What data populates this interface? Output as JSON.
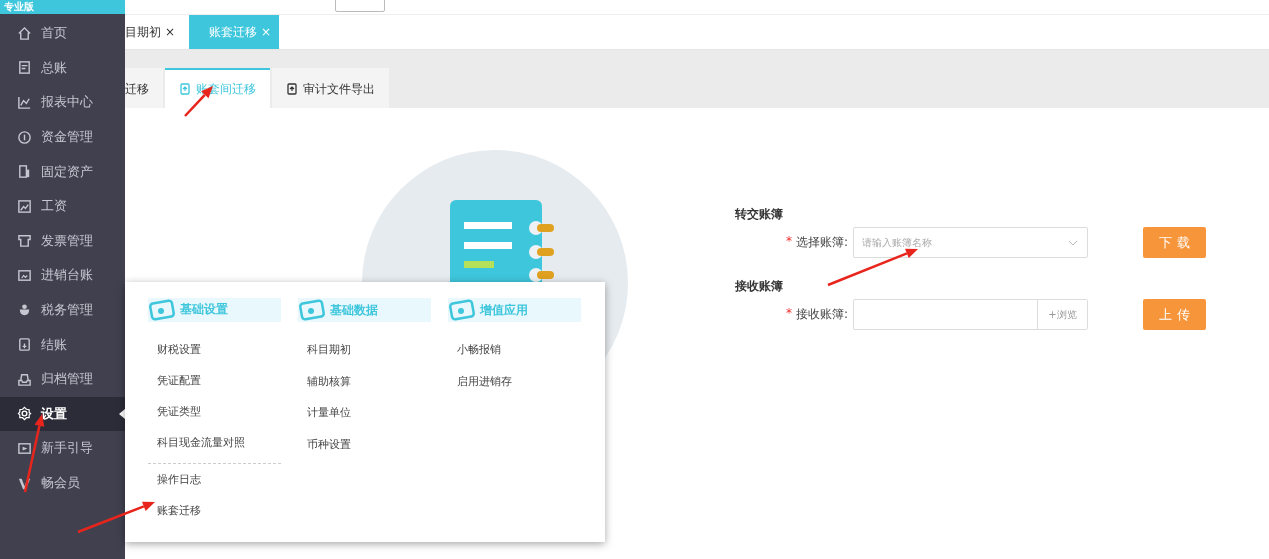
{
  "sidebar": {
    "badge": "专业版",
    "items": [
      {
        "label": "首页",
        "selected": false
      },
      {
        "label": "总账",
        "selected": false
      },
      {
        "label": "报表中心",
        "selected": false
      },
      {
        "label": "资金管理",
        "selected": false
      },
      {
        "label": "固定资产",
        "selected": false
      },
      {
        "label": "工资",
        "selected": false
      },
      {
        "label": "发票管理",
        "selected": false
      },
      {
        "label": "进销台账",
        "selected": false
      },
      {
        "label": "税务管理",
        "selected": false
      },
      {
        "label": "结账",
        "selected": false
      },
      {
        "label": "归档管理",
        "selected": false
      },
      {
        "label": "设置",
        "selected": true
      },
      {
        "label": "新手引导",
        "selected": false
      },
      {
        "label": "畅会员",
        "selected": false
      }
    ]
  },
  "tabs": [
    {
      "label": "目期初",
      "close": "×",
      "selected": false
    },
    {
      "label": "账套迁移",
      "close": "×",
      "selected": true
    }
  ],
  "subtabs": [
    {
      "label": "迁移",
      "selected": false
    },
    {
      "label": "账套间迁移",
      "selected": true
    },
    {
      "label": "审计文件导出",
      "selected": false
    }
  ],
  "form": {
    "sections": [
      {
        "title": "转交账簿",
        "required": "*",
        "label": "选择账簿:",
        "kind": "select",
        "placeholder": "请输入账簿名称",
        "button": "下 载"
      },
      {
        "title": "接收账簿",
        "required": "*",
        "label": "接收账簿:",
        "kind": "file",
        "browse": "+浏览",
        "button": "上 传"
      }
    ]
  },
  "menu": {
    "columns": [
      {
        "title": "基础设置",
        "items": [
          "财税设置",
          "凭证配置",
          "凭证类型",
          "科目现金流量对照"
        ],
        "extra_items": [
          "操作日志",
          "账套迁移"
        ]
      },
      {
        "title": "基础数据",
        "items": [
          "科目期初",
          "辅助核算",
          "计量单位",
          "币种设置"
        ]
      },
      {
        "title": "增值应用",
        "items": [
          "小畅报销",
          "启用进销存"
        ]
      }
    ]
  }
}
